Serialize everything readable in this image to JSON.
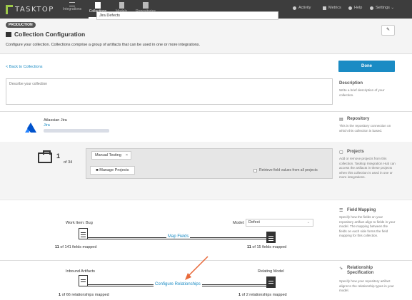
{
  "nav": {
    "logo": "TASKTOP",
    "tabs": [
      {
        "label": "Integrations"
      },
      {
        "label": "Collections"
      },
      {
        "label": "Models"
      },
      {
        "label": "Repositories"
      }
    ],
    "right": [
      {
        "label": "Activity"
      },
      {
        "label": "Metrics"
      },
      {
        "label": "Help"
      },
      {
        "label": "Settings ⌄"
      }
    ]
  },
  "header": {
    "badge": "PRODUCTION",
    "title": "Collection Configuration",
    "name_value": "Jira Defects",
    "subtitle": "Configure your collection. Collections comprise a group of artifacts that can be used in one or more integrations.",
    "pin": "✎"
  },
  "toolbar": {
    "back": "< Back to Collections",
    "done": "Done"
  },
  "description": {
    "placeholder": "Describe your collection",
    "side_title": "Description",
    "side_text": "Write a brief description of your collection."
  },
  "repository": {
    "name": "Atlassian Jira",
    "link": "Jira",
    "side_title": "Repository",
    "side_text": "This is the repository connection on which this collection is based."
  },
  "projects": {
    "count": "1",
    "of": "of 34",
    "chip": "Manual Testing",
    "chip_x": "×",
    "manage": "Manage Projects",
    "retrieve": "Retrieve field values from all projects",
    "side_title": "Projects",
    "side_text": "Add or remove projects from this collection. Tasktop Integration Hub can access the artifacts in these projects when this collection is used in one or more integrations."
  },
  "field_mapping": {
    "work_item": "Work Item: Bug",
    "map_link": "Map Fields",
    "model_label": "Model:",
    "model_value": "Defect",
    "left_count": "11",
    "left_rest": "of 141 fields mapped",
    "right_count": "11",
    "right_rest": "of 15 fields mapped",
    "side_title": "Field Mapping",
    "side_text": "Specify how the fields on your repository artifact align to fields in your model. The mapping between the fields on each side forms the field mapping for this collection."
  },
  "relationship": {
    "inbound": "Inbound Artifacts",
    "relating": "Relating Model",
    "cfg_link": "Configure Relationships",
    "left_count": "1",
    "left_rest": "of 66 relationships mapped",
    "right_count": "1",
    "right_rest": "of 2 relationships mapped",
    "side_title": "Relationship Specification",
    "side_text": "Specify how your repository artifact aligns to the relationship types in your model."
  },
  "colors": {
    "accent": "#1a8bc4",
    "nav_bg": "#3d3d3d",
    "arrow": "#e8693a"
  }
}
